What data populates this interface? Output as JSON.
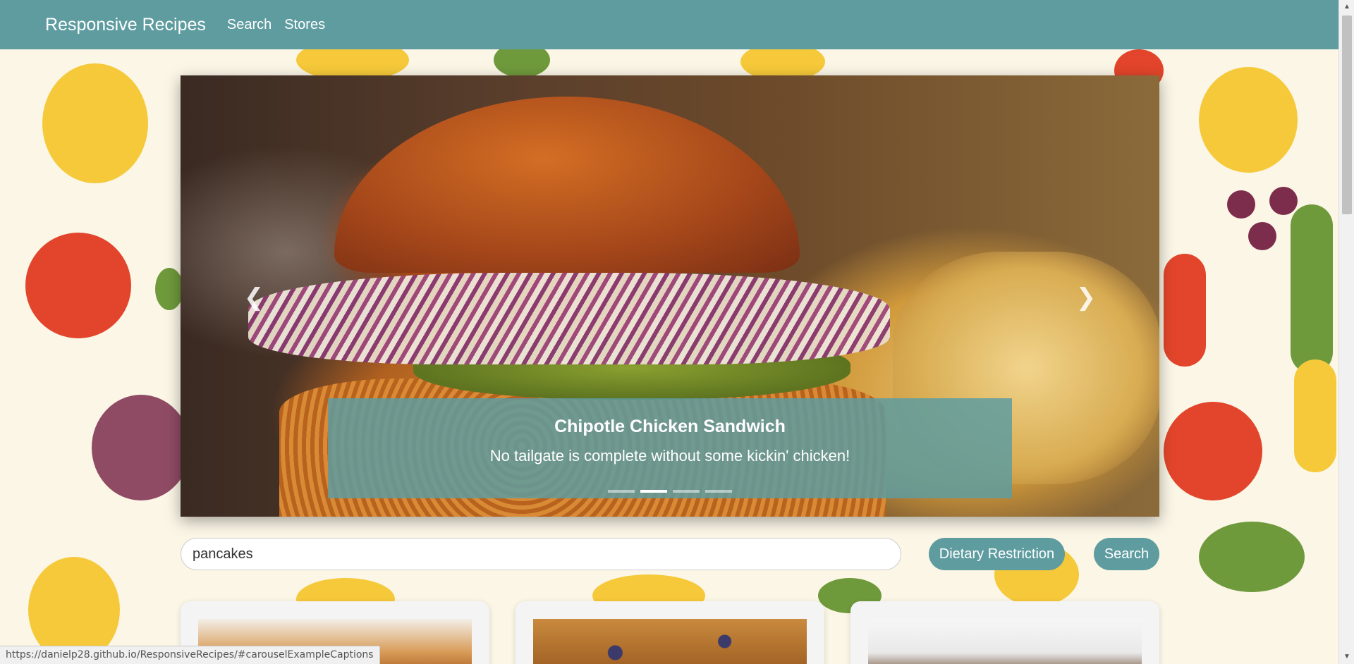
{
  "navbar": {
    "brand": "Responsive Recipes",
    "links": [
      "Search",
      "Stores"
    ]
  },
  "carousel": {
    "caption_title": "Chipotle Chicken Sandwich",
    "caption_text": "No tailgate is complete without some kickin' chicken!",
    "indicator_count": 4,
    "active_index": 1
  },
  "search": {
    "value": "pancakes",
    "dietary_label": "Dietary Restriction",
    "search_label": "Search"
  },
  "status_bar": {
    "url": "https://danielp28.github.io/ResponsiveRecipes/#carouselExampleCaptions"
  },
  "colors": {
    "accent": "#5e9ca0",
    "background": "#fbf6e6"
  },
  "icons": {
    "prev": "chevron-left-icon",
    "next": "chevron-right-icon"
  }
}
